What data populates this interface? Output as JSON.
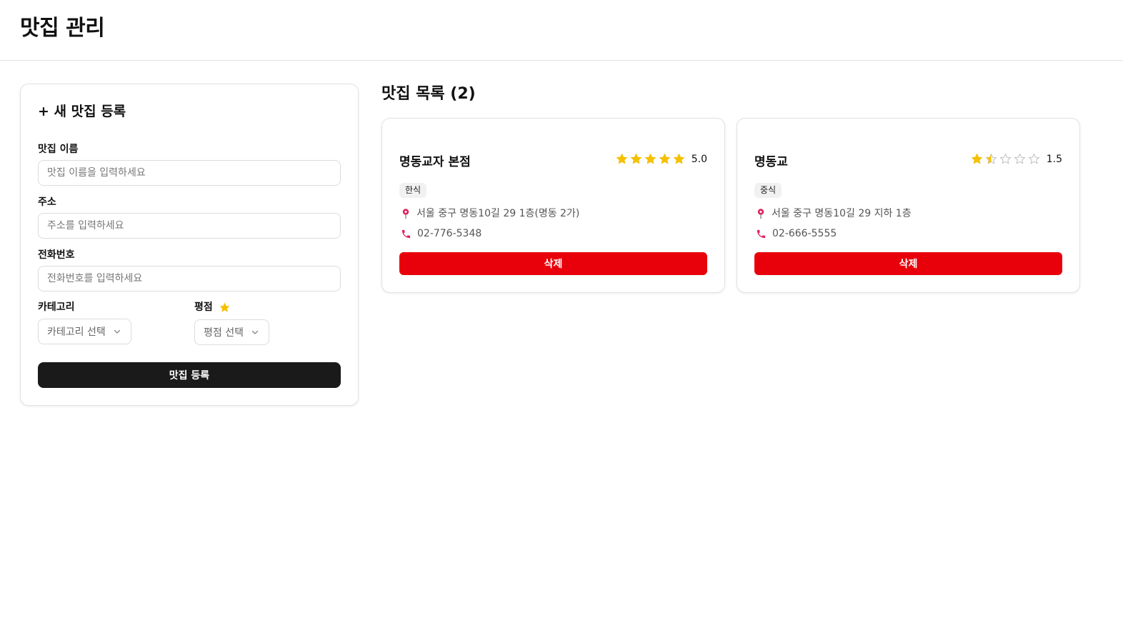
{
  "header": {
    "title": "맛집 관리"
  },
  "form": {
    "title": "+ 새 맛집 등록",
    "name_label": "맛집 이름",
    "name_placeholder": "맛집 이름을 입력하세요",
    "address_label": "주소",
    "address_placeholder": "주소를 입력하세요",
    "phone_label": "전화번호",
    "phone_placeholder": "전화번호를 입력하세요",
    "category_label": "카테고리",
    "category_select": "카테고리 선택",
    "rating_label": "평점",
    "rating_select": "평점 선택",
    "submit_label": "맛집 등록"
  },
  "list": {
    "title": "맛집 목록 (2)",
    "restaurants": [
      {
        "name": "명동교자 본점",
        "rating": 5.0,
        "rating_text": "5.0",
        "category": "한식",
        "address": "서울 중구 명동10길 29 1층(명동 2가)",
        "phone": "02-776-5348",
        "delete_label": "삭제"
      },
      {
        "name": "명동교",
        "rating": 1.5,
        "rating_text": "1.5",
        "category": "중식",
        "address": "서울 중구 명동10길 29 지하 1층",
        "phone": "02-666-5555",
        "delete_label": "삭제"
      }
    ]
  },
  "colors": {
    "star": "#f5c000",
    "star_empty": "#bdbdbd",
    "danger": "#e8000b",
    "primary_dark": "#1a1a1a",
    "icon_pink": "#e0245e"
  },
  "icons": {
    "rating_label": "star-icon",
    "address": "map-pin-icon",
    "phone": "phone-icon",
    "select": "chevron-down-icon"
  }
}
